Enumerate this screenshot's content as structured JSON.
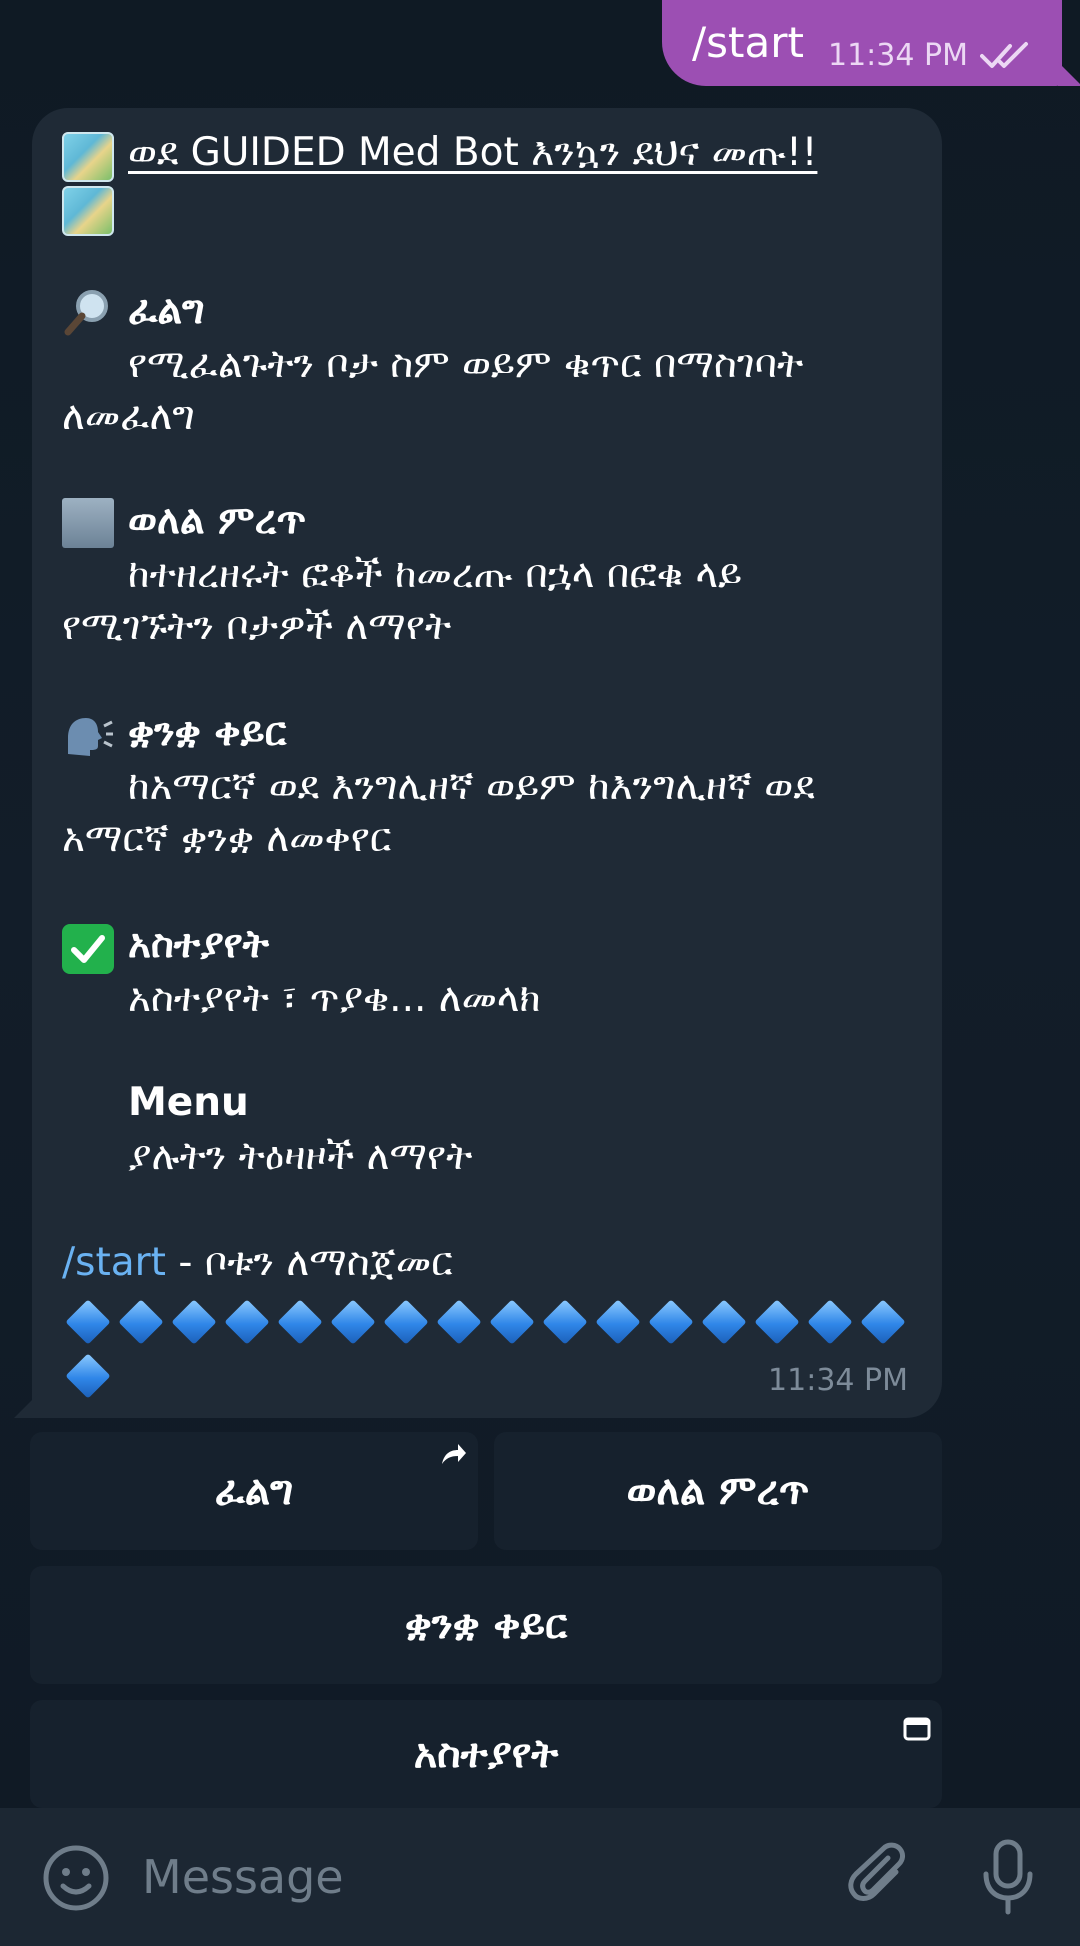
{
  "outgoing": {
    "text": "/start",
    "time": "11:34 PM",
    "status_icon": "double-check-icon"
  },
  "incoming": {
    "title": "ወደ GUIDED Med Bot እንኳን ደህና መጡ!!",
    "sections": [
      {
        "icon": "magnifier-icon",
        "heading": "ፈልግ",
        "desc_line1": "የሚፈልጉትን ቦታ ስም ወይም ቁጥር በማስገባት",
        "desc_line2": "ለመፈለግ"
      },
      {
        "icon": "building-icon",
        "heading": "ወለል ምረጥ",
        "desc_line1": "ከተዘረዘሩት ፎቆች ከመረጡ በኋላ በፎቁ ላይ",
        "desc_line2": "የሚገኙትን ቦታዎች ለማየት"
      },
      {
        "icon": "speaking-head-icon",
        "heading": "ቋንቋ ቀይር",
        "desc_line1": "ከአማርኛ ወደ እንግሊዘኛ ወይም ከእንግሊዘኛ ወደ",
        "desc_line2": "አማርኛ ቋንቋ ለመቀየር"
      },
      {
        "icon": "check-mark-icon",
        "heading": "አስተያየት",
        "desc_line1": "አስተያየት ፣ ጥያቄ... ለመላክ",
        "desc_line2": ""
      },
      {
        "icon": "menu-icon",
        "heading": "Menu",
        "desc_line1": "ያሉትን ትዕዛዞች ለማየት",
        "desc_line2": ""
      }
    ],
    "start_command": "/start",
    "start_desc": " - ቦቱን ለማስጀመር",
    "time": "11:34 PM"
  },
  "keyboard": {
    "search": "ፈልግ",
    "floor": "ወለል ምረጥ",
    "language": "ቋንቋ ቀይር",
    "feedback": "አስተያየት"
  },
  "input": {
    "placeholder": "Message"
  },
  "colors": {
    "background": "#0e1621",
    "outgoing_bubble": "#9c4fb3",
    "incoming_bubble": "#1f2a36",
    "link": "#6ab2f2",
    "keyboard_button": "#16212d",
    "input_bar": "#1c2733"
  }
}
